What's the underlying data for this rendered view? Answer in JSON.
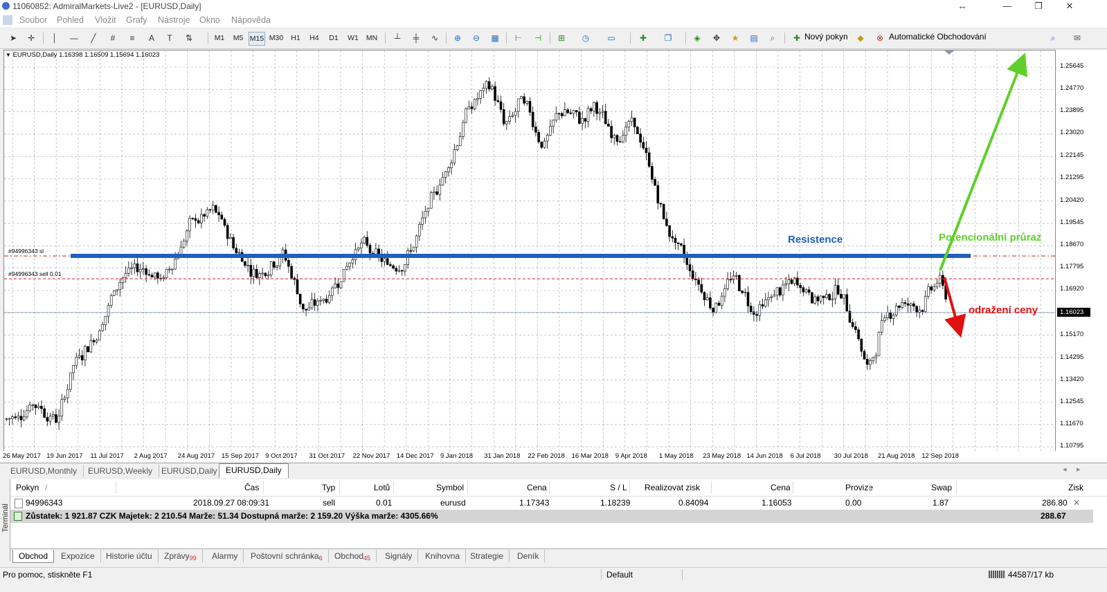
{
  "window": {
    "title": "11060852: AdmiralMarkets-Live2 - [EURUSD,Daily]",
    "resize_glyph": "↔",
    "minimize_glyph": "—",
    "restore_glyph": "❐",
    "close_glyph": "✕"
  },
  "menu": [
    "Soubor",
    "Pohled",
    "Vložit",
    "Grafy",
    "Nástroje",
    "Okno",
    "Nápověda"
  ],
  "toolbar": {
    "timeframes": [
      "M1",
      "M5",
      "M15",
      "M30",
      "H1",
      "H4",
      "D1",
      "W1",
      "MN"
    ],
    "selected_timeframe": "M15",
    "new_order_label": "Nový pokyn",
    "autotrading_label": "Automatické Obchodování"
  },
  "chart": {
    "symbol_info": "EURUSD,Daily  1.16398 1.16509 1.15694 1.16023",
    "current_price": "1.16023",
    "price_labels": [
      "1.25645",
      "1.24770",
      "1.23895",
      "1.23020",
      "1.22145",
      "1.21295",
      "1.20420",
      "1.19545",
      "1.18670",
      "1.17795",
      "1.16920",
      "1.16023",
      "1.15170",
      "1.14295",
      "1.13420",
      "1.12545",
      "1.11670",
      "1.10795"
    ],
    "date_labels": [
      "26 May 2017",
      "19 Jun 2017",
      "11 Jul 2017",
      "2 Aug 2017",
      "24 Aug 2017",
      "15 Sep 2017",
      "9 Oct 2017",
      "31 Oct 2017",
      "22 Nov 2017",
      "14 Dec 2017",
      "9 Jan 2018",
      "31 Jan 2018",
      "22 Feb 2018",
      "16 Mar 2018",
      "9 Apr 2018",
      "1 May 2018",
      "23 May 2018",
      "14 Jun 2018",
      "6 Jul 2018",
      "30 Jul 2018",
      "21 Aug 2018",
      "12 Sep 2018"
    ],
    "sl_label": "#94996343 sl",
    "sell_label": "#94996343 sell 0.01",
    "resistance_label": "Resistence",
    "breakout_label": "Potencionální průraz",
    "bounce_label": "odražení ceny",
    "colors": {
      "resistance": "#1f5fbf",
      "breakout": "#5fd02a",
      "bounce": "#e01010",
      "levels": "#d02020"
    }
  },
  "chart_tabs": [
    "EURUSD,Monthly",
    "EURUSD,Weekly",
    "EURUSD,Daily",
    "EURUSD,Daily"
  ],
  "terminal": {
    "side_label": "Terminál",
    "headers": [
      "Pokyn",
      "/",
      "Čas",
      "Typ",
      "Lotů",
      "Symbol",
      "Cena",
      "S / L",
      "Realizovat zisk",
      "Cena",
      "Provize",
      "Swap",
      "Zisk"
    ],
    "row": {
      "order": "94996343",
      "time": "2018.09.27 08:09:31",
      "type": "sell",
      "lots": "0.01",
      "symbol": "eurusd",
      "price": "1.17343",
      "sl": "1.18239",
      "tp": "0.84094",
      "cur_price": "1.16053",
      "commission": "0.00",
      "swap": "1.87",
      "profit": "286.80"
    },
    "balance": "Zůstatek: 1 921.87 CZK  Majetek: 2 210.54  Marže: 51.34  Dostupná marže: 2 159.20  Výška marže: 4305.66%",
    "total_profit": "288.67",
    "tabs": [
      {
        "label": "Obchod",
        "badge": ""
      },
      {
        "label": "Expozice",
        "badge": ""
      },
      {
        "label": "Historie účtu",
        "badge": ""
      },
      {
        "label": "Zprávy",
        "badge": "99"
      },
      {
        "label": "Alarmy",
        "badge": ""
      },
      {
        "label": "Poštovní schránka",
        "badge": "6"
      },
      {
        "label": "Obchod",
        "badge": "45"
      },
      {
        "label": "Signály",
        "badge": ""
      },
      {
        "label": "Knihovna",
        "badge": ""
      },
      {
        "label": "Strategie",
        "badge": ""
      },
      {
        "label": "Deník",
        "badge": ""
      }
    ]
  },
  "status": {
    "help": "Pro pomoc, stiskněte F1",
    "profile": "Default",
    "traffic": "44587/17 kb"
  }
}
